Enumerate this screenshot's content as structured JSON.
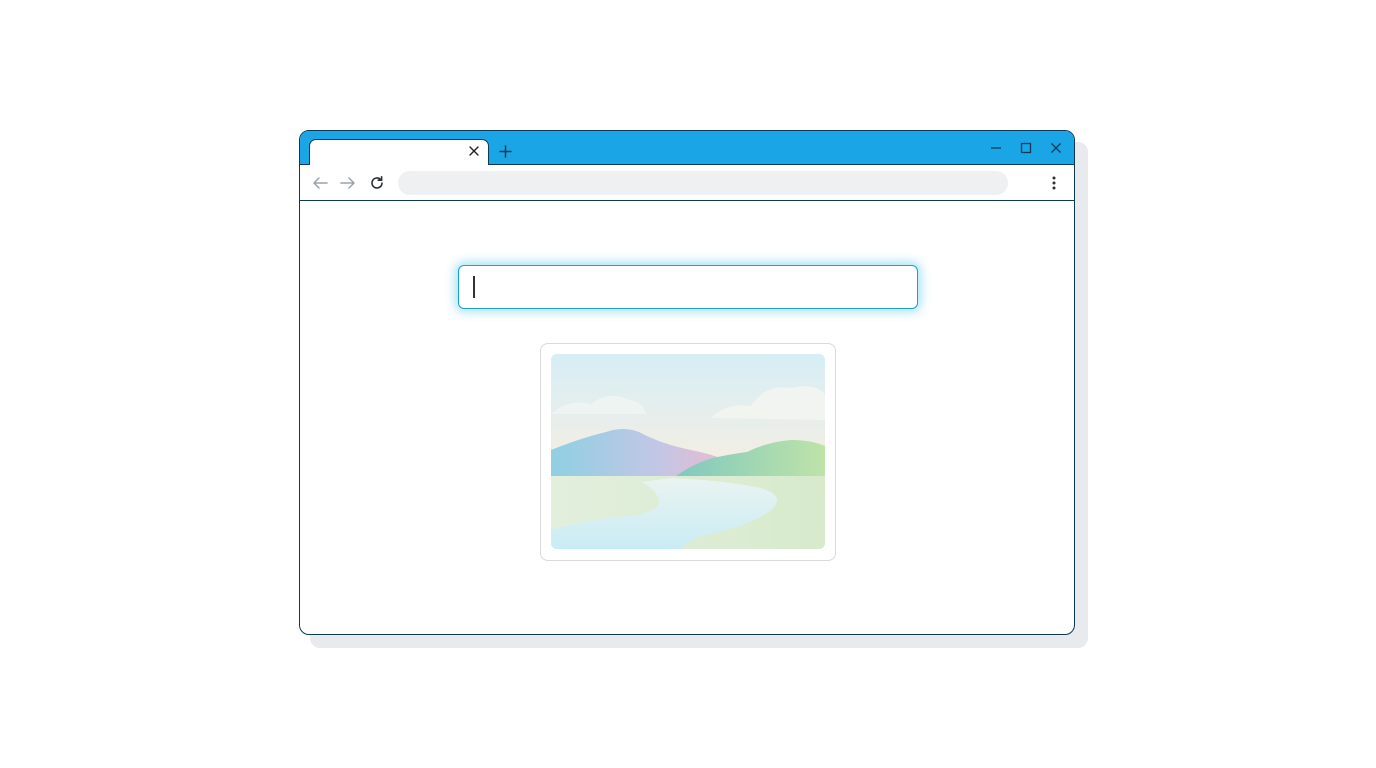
{
  "browser": {
    "tab": {
      "title": "",
      "close_icon": "close-icon"
    },
    "new_tab_icon": "plus-icon",
    "window_controls": [
      "minimize-icon",
      "maximize-icon",
      "close-icon"
    ],
    "toolbar": {
      "back_icon": "arrow-left-icon",
      "forward_icon": "arrow-right-icon",
      "reload_icon": "reload-icon",
      "address_value": "",
      "menu_icon": "kebab-menu-icon"
    }
  },
  "page": {
    "search_input": {
      "value": "",
      "placeholder": ""
    },
    "image_card": {
      "icon": "landscape-image-icon"
    }
  },
  "colors": {
    "titlebar": "#1aa6e6",
    "border": "#0e3a55",
    "focus_ring": "#1a9fd6",
    "address_bar": "#eef0f2"
  }
}
